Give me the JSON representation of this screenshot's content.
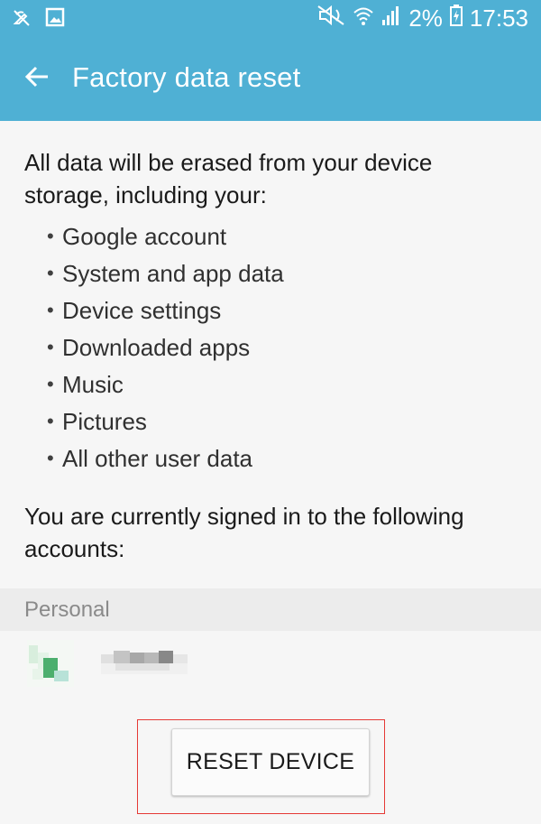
{
  "status_bar": {
    "battery": "2%",
    "time": "17:53",
    "icons": [
      "notification-off-icon",
      "image-icon",
      "mute-icon",
      "wifi-icon",
      "signal-icon",
      "battery-charging-icon"
    ]
  },
  "app_bar": {
    "title": "Factory data reset",
    "back_icon": "back-arrow-icon"
  },
  "main": {
    "intro": "All data will be erased from your device storage, including your:",
    "bullet_char": "•",
    "items": [
      "Google account",
      "System and app data",
      "Device settings",
      "Downloaded apps",
      "Music",
      "Pictures",
      "All other user data"
    ],
    "signed_in_text": "You are currently signed in to the following accounts:",
    "section_header": "Personal"
  },
  "reset_button": {
    "label": "RESET DEVICE"
  },
  "colors": {
    "app_bar": "#4fb0d4",
    "background": "#f6f6f6",
    "highlight": "#e53935"
  }
}
